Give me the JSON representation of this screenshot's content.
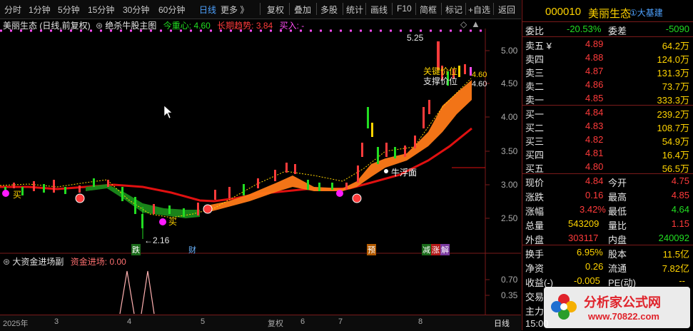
{
  "toolbar": {
    "periods": [
      "分时",
      "1分钟",
      "5分钟",
      "15分钟",
      "30分钟",
      "60分钟",
      "日线",
      "更多 》"
    ],
    "tools": [
      "复权",
      "叠加",
      "多股",
      "统计",
      "画线",
      "F10",
      "简框",
      "标记",
      "+自选",
      "返回"
    ]
  },
  "main_chart": {
    "stock_label": "美丽生态 (日线,前复权)",
    "indicator_name": "绝杀牛股主图",
    "center_label": "今重心:",
    "center_value": "4.60",
    "trend_label": "长期趋势:",
    "trend_value": "3.84",
    "buy_label": "买入:",
    "buy_value": "-",
    "y_ticks": [
      "5.00",
      "4.50",
      "4.00",
      "3.50",
      "3.00",
      "2.50"
    ],
    "high_label": "5.25",
    "low_label": "2.16",
    "annotations": {
      "key_level": "关键价位",
      "support_level": "支撑价位",
      "key_value": "4.60",
      "support_value": "4.60",
      "bull_surface": "牛浮面",
      "buy1": "买",
      "buy2": "买"
    },
    "event_tags": [
      "跌",
      "财",
      "预",
      "减",
      "涨",
      "解"
    ]
  },
  "sub_chart": {
    "indicator_name": "大资金进场副",
    "series_label": "资金进场:",
    "series_value": "0.00",
    "y_ticks": [
      "0.70",
      "0.35"
    ]
  },
  "x_axis": {
    "labels": [
      "2025年",
      "3",
      "4",
      "5",
      "复权",
      "6",
      "7",
      "8"
    ],
    "period_tab": "日线"
  },
  "quote": {
    "code": "000010",
    "name": "美丽生态",
    "tag": "①大基建",
    "webi_label": "委比",
    "webi_value": "-20.53%",
    "weicha_label": "委差",
    "weicha_value": "-5090",
    "asks": [
      {
        "label": "卖五 ¥",
        "price": "4.89",
        "vol": "64.2万"
      },
      {
        "label": "卖四",
        "price": "4.88",
        "vol": "124.0万"
      },
      {
        "label": "卖三",
        "price": "4.87",
        "vol": "131.3万"
      },
      {
        "label": "卖二",
        "price": "4.86",
        "vol": "73.7万"
      },
      {
        "label": "卖一",
        "price": "4.85",
        "vol": "333.3万"
      }
    ],
    "bids": [
      {
        "label": "买一",
        "price": "4.84",
        "vol": "239.2万"
      },
      {
        "label": "买二",
        "price": "4.83",
        "vol": "108.7万"
      },
      {
        "label": "买三",
        "price": "4.82",
        "vol": "54.9万"
      },
      {
        "label": "买四",
        "price": "4.81",
        "vol": "16.4万"
      },
      {
        "label": "买五",
        "price": "4.80",
        "vol": "56.5万"
      }
    ],
    "stats": [
      {
        "l1": "现价",
        "v1": "4.84",
        "l2": "今开",
        "v2": "4.75"
      },
      {
        "l1": "涨跌",
        "v1": "0.16",
        "l2": "最高",
        "v2": "4.85"
      },
      {
        "l1": "涨幅",
        "v1": "3.42%",
        "l2": "最低",
        "v2": "4.64"
      },
      {
        "l1": "总量",
        "v1": "543209",
        "l2": "量比",
        "v2": "1.15"
      },
      {
        "l1": "外盘",
        "v1": "303117",
        "l2": "内盘",
        "v2": "240092"
      }
    ],
    "stats2": [
      {
        "l1": "换手",
        "v1": "6.95%",
        "l2": "股本",
        "v2": "11.5亿"
      },
      {
        "l1": "净资",
        "v1": "0.26",
        "l2": "流通",
        "v2": "7.82亿"
      },
      {
        "l1": "收益(-)",
        "v1": "-0.005",
        "l2": "PE(动)",
        "v2": "--"
      }
    ],
    "extra_rows": [
      "交易",
      "主力",
      "15:00"
    ]
  },
  "watermark": {
    "site": "分析家公式网",
    "url": "www.70822.com"
  },
  "colors": {
    "up": "#ff3b3b",
    "down": "#22dd22",
    "band": "#ff7a18",
    "trend": "#e01010",
    "accent": "#4ea2ff"
  }
}
